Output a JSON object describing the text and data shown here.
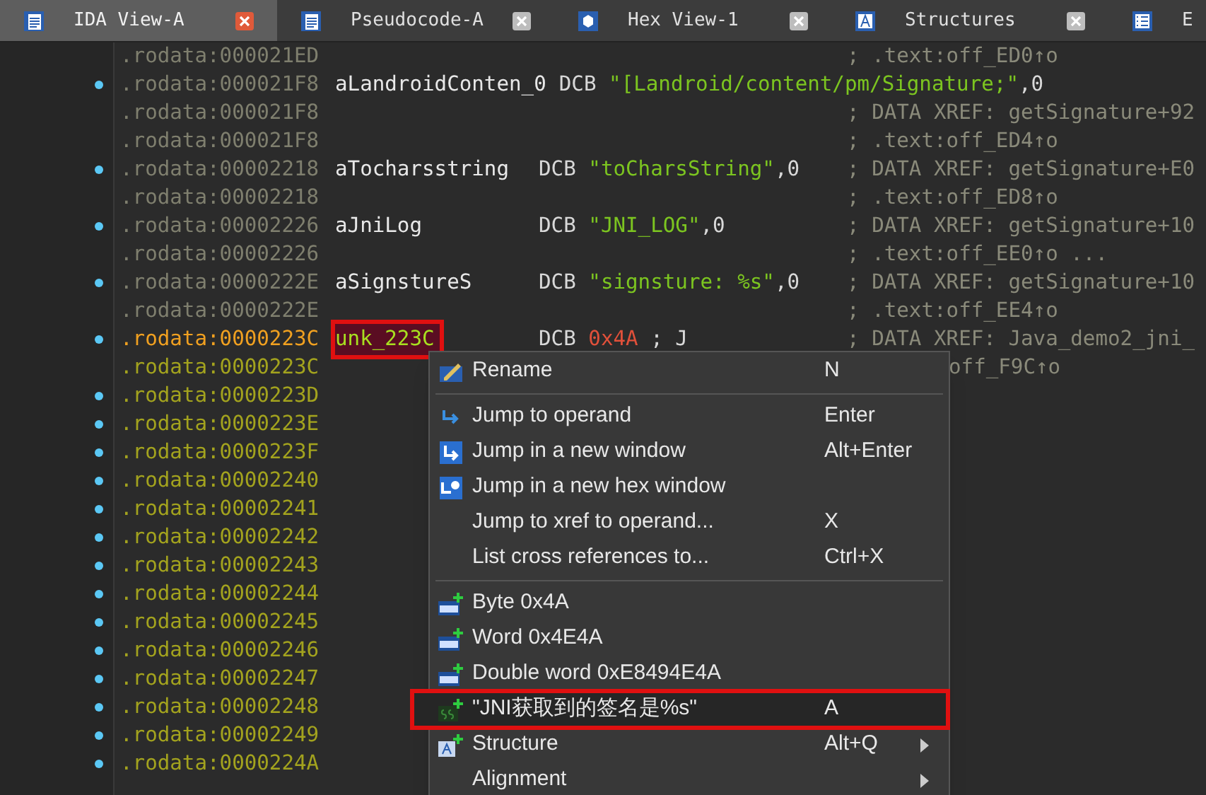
{
  "tabs": [
    {
      "label": "IDA View-A",
      "selected": true,
      "closable": true
    },
    {
      "label": "Pseudocode-A",
      "selected": false,
      "closable": true
    },
    {
      "label": "Hex View-1",
      "selected": false,
      "closable": true
    },
    {
      "label": "Structures",
      "selected": false,
      "closable": true
    },
    {
      "label": "E",
      "selected": false
    }
  ],
  "rows": [
    {
      "address": ".rodata:000021ED",
      "kind": "plain",
      "dot": false,
      "comment": "; .text:off_ED0↑o"
    },
    {
      "address": ".rodata:000021F8",
      "kind": "plain",
      "dot": true,
      "label": "aLandroidConten_0",
      "directive": "DCB",
      "operand": "\"[Landroid/content/pm/Signature;\"",
      "suffix": ",0"
    },
    {
      "address": ".rodata:000021F8",
      "kind": "plain",
      "dot": false,
      "comment": "; DATA XREF: getSignature+92"
    },
    {
      "address": ".rodata:000021F8",
      "kind": "plain",
      "dot": false,
      "comment": "; .text:off_ED4↑o"
    },
    {
      "address": ".rodata:00002218",
      "kind": "plain",
      "dot": true,
      "label": "aTocharsstring",
      "directive": "DCB",
      "operand": "\"toCharsString\"",
      "suffix": ",0",
      "comment": "; DATA XREF: getSignature+E0"
    },
    {
      "address": ".rodata:00002218",
      "kind": "plain",
      "dot": false,
      "comment": "; .text:off_ED8↑o"
    },
    {
      "address": ".rodata:00002226",
      "kind": "plain",
      "dot": true,
      "label": "aJniLog",
      "directive": "DCB",
      "operand": "\"JNI_LOG\"",
      "suffix": ",0",
      "comment": "; DATA XREF: getSignature+10"
    },
    {
      "address": ".rodata:00002226",
      "kind": "plain",
      "dot": false,
      "comment": "; .text:off_EE0↑o ..."
    },
    {
      "address": ".rodata:0000222E",
      "kind": "plain",
      "dot": true,
      "label": "aSignstureS",
      "directive": "DCB",
      "operand": "\"signsture: %s\"",
      "suffix": ",0",
      "comment": "; DATA XREF: getSignature+10"
    },
    {
      "address": ".rodata:0000222E",
      "kind": "plain",
      "dot": false,
      "comment": "; .text:off_EE4↑o"
    },
    {
      "address": ".rodata:0000223C",
      "kind": "current",
      "dot": true,
      "label": "unk_223C",
      "highlighted": true,
      "annotated": true,
      "directive": "DCB",
      "value": "0x4A",
      "suffix": " ; J",
      "comment": "; DATA XREF: Java_demo2_jni_"
    },
    {
      "address": ".rodata:0000223C",
      "kind": "data",
      "dot": false,
      "comment": "off_F9C↑o",
      "covered": true
    },
    {
      "address": ".rodata:0000223D",
      "kind": "data",
      "dot": true
    },
    {
      "address": ".rodata:0000223E",
      "kind": "data",
      "dot": true
    },
    {
      "address": ".rodata:0000223F",
      "kind": "data",
      "dot": true
    },
    {
      "address": ".rodata:00002240",
      "kind": "data",
      "dot": true
    },
    {
      "address": ".rodata:00002241",
      "kind": "data",
      "dot": true
    },
    {
      "address": ".rodata:00002242",
      "kind": "data",
      "dot": true
    },
    {
      "address": ".rodata:00002243",
      "kind": "data",
      "dot": true
    },
    {
      "address": ".rodata:00002244",
      "kind": "data",
      "dot": true
    },
    {
      "address": ".rodata:00002245",
      "kind": "data",
      "dot": true
    },
    {
      "address": ".rodata:00002246",
      "kind": "data",
      "dot": true
    },
    {
      "address": ".rodata:00002247",
      "kind": "data",
      "dot": true
    },
    {
      "address": ".rodata:00002248",
      "kind": "data",
      "dot": true
    },
    {
      "address": ".rodata:00002249",
      "kind": "data",
      "dot": true
    },
    {
      "address": ".rodata:0000224A",
      "kind": "data",
      "dot": true
    }
  ],
  "context_menu": {
    "groups": [
      [
        {
          "label": "Rename",
          "shortcut": "N",
          "selected": false
        }
      ],
      [
        {
          "label": "Jump to operand",
          "shortcut": "Enter",
          "selected": false
        },
        {
          "label": "Jump in a new window",
          "shortcut": "Alt+Enter",
          "selected": false
        },
        {
          "label": "Jump in a new hex window",
          "selected": false
        },
        {
          "label": "Jump to xref to operand...",
          "shortcut": "X",
          "selected": false
        },
        {
          "label": "List cross references to...",
          "shortcut": "Ctrl+X",
          "selected": false
        }
      ],
      [
        {
          "label": "Byte 0x4A",
          "selected": false
        },
        {
          "label": "Word 0x4E4A",
          "selected": false
        },
        {
          "label": "Double word 0xE8494E4A",
          "selected": false
        },
        {
          "label": "\"JNI获取到的签名是%s\"",
          "shortcut": "A",
          "selected": true,
          "annotated": true
        },
        {
          "label": "Structure",
          "shortcut": "Alt+Q",
          "selected": false,
          "submenu": true
        },
        {
          "label": "Alignment",
          "selected": false,
          "submenu": true
        }
      ]
    ]
  }
}
